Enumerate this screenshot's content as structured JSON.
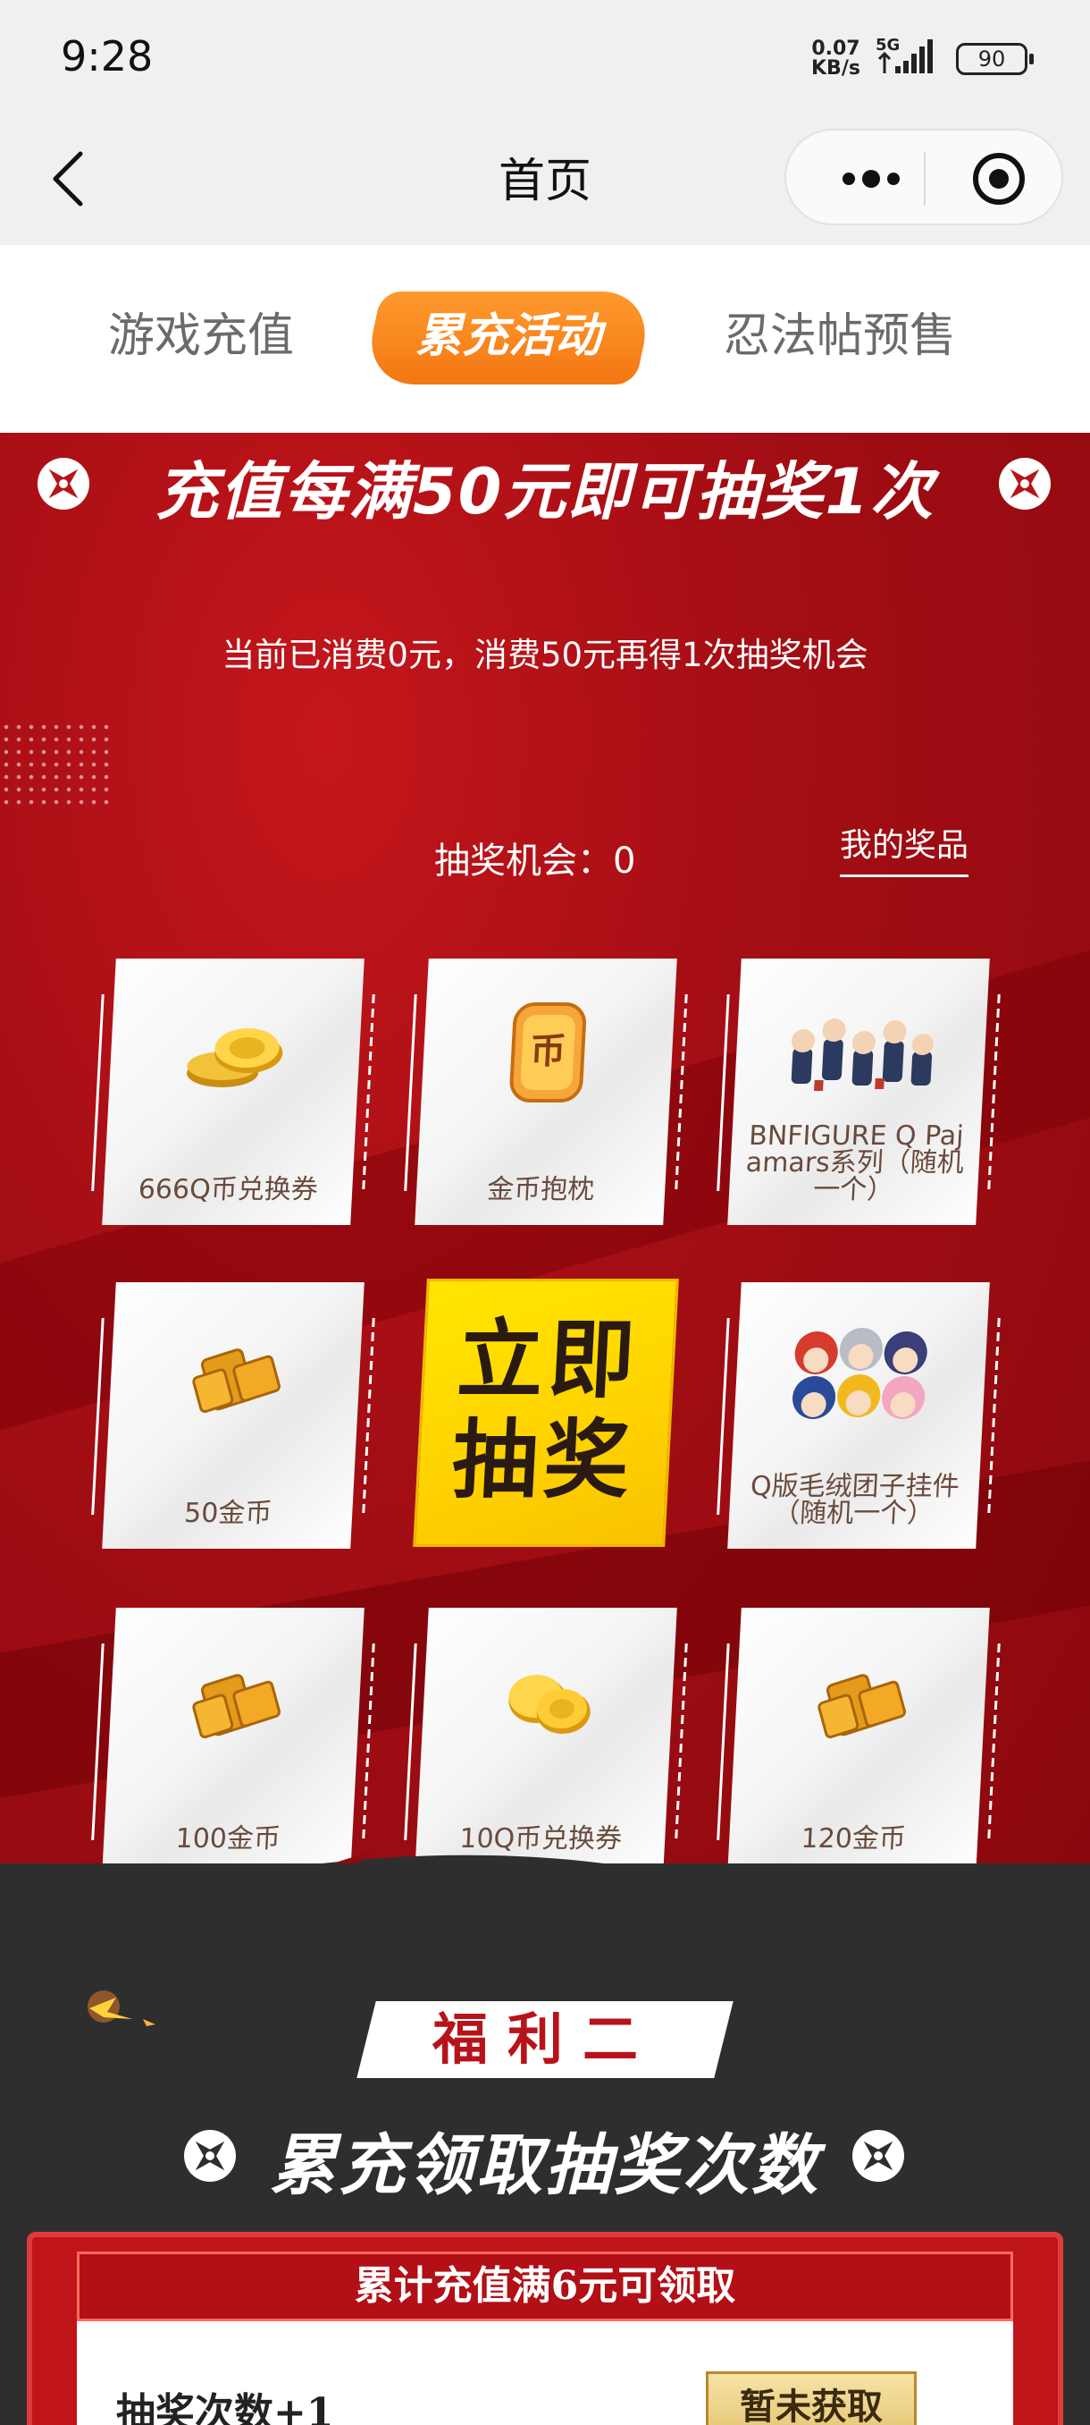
{
  "status_bar": {
    "time": "9:28",
    "net_speed_value": "0.07",
    "net_speed_unit": "KB/s",
    "network": "5G",
    "battery": "90"
  },
  "nav": {
    "title": "首页"
  },
  "tabs": [
    {
      "label": "游戏充值",
      "active": false
    },
    {
      "label": "累充活动",
      "active": true
    },
    {
      "label": "忍法帖预售",
      "active": false
    }
  ],
  "lottery": {
    "headline": "充值每满50元即可抽奖1次",
    "spent_text": "当前已消费0元，消费50元再得1次抽奖机会",
    "chances_label": "抽奖机会：",
    "chances_value": "0",
    "my_prizes": "我的奖品",
    "draw_button": "立即抽奖",
    "prizes": [
      {
        "name": "666Q币兑换券",
        "icon": "qcoin-stack-icon"
      },
      {
        "name": "金币抱枕",
        "icon": "coin-pillow-icon"
      },
      {
        "name": "BNFIGURE Q Pajamars系列（随机一个）",
        "icon": "figures-icon"
      },
      {
        "name": "50金币",
        "icon": "gold-bars-icon"
      },
      {
        "name": "Q版毛绒团子挂件（随机一个）",
        "icon": "plush-icon"
      },
      {
        "name": "100金币",
        "icon": "gold-bars-icon"
      },
      {
        "name": "10Q币兑换券",
        "icon": "qcoin-pair-icon"
      },
      {
        "name": "120金币",
        "icon": "gold-bars-icon"
      }
    ]
  },
  "welfare": {
    "badge": "福利二",
    "title": "累充领取抽奖次数",
    "tier_header": "累计充值满6元可领取",
    "tier_reward": "抽奖次数+1",
    "tier_button": "暂未获取"
  },
  "colors": {
    "tab_active": "#f47613",
    "red_bg": "#a40e14",
    "dark_bg": "#2e2e2e",
    "draw_yellow": "#ffd800"
  }
}
